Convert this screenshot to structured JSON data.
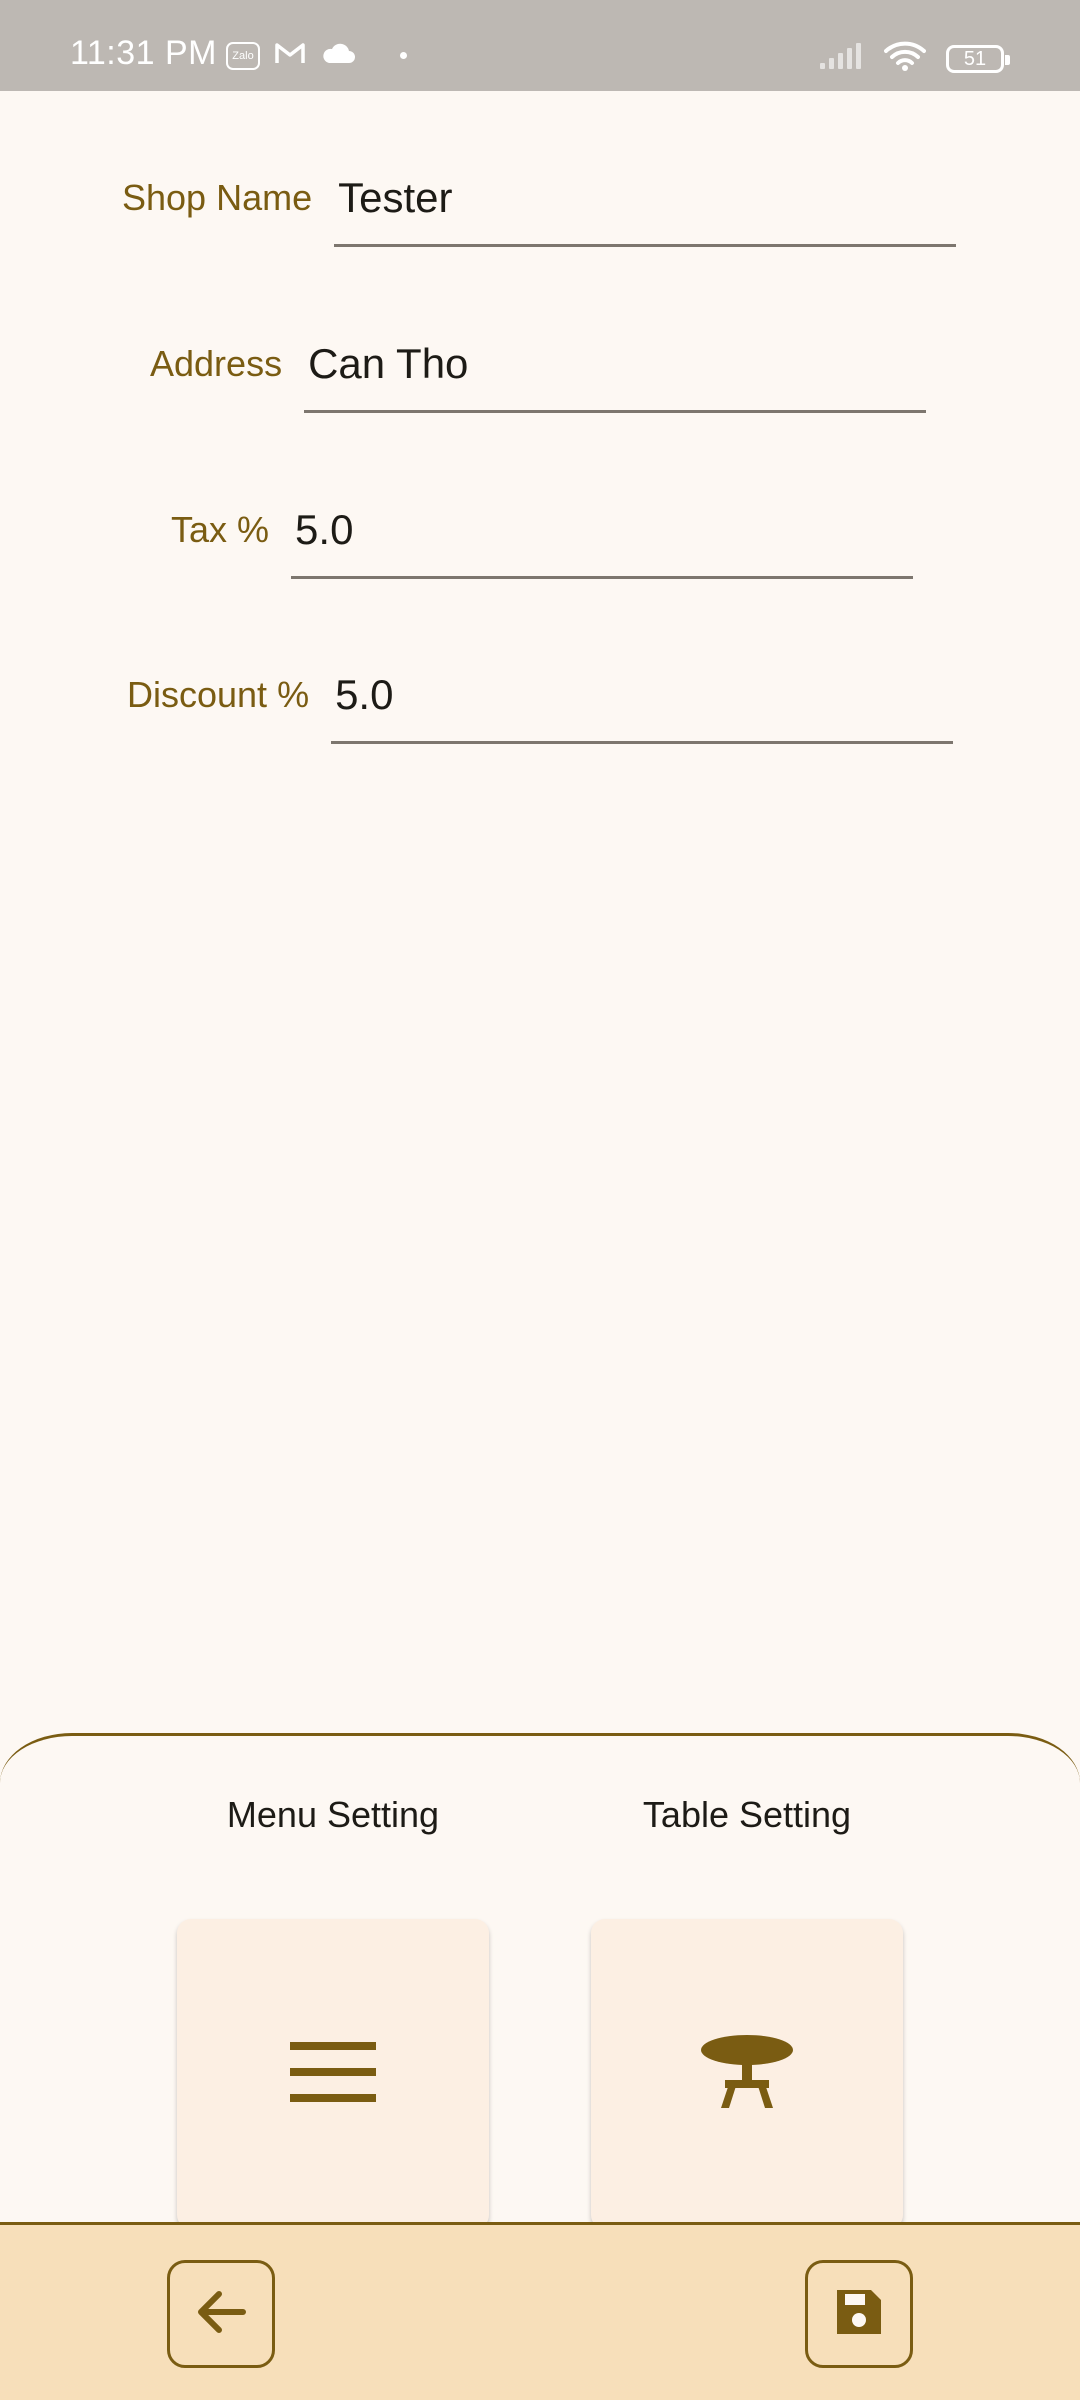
{
  "status_bar": {
    "time": "11:31 PM",
    "zalo_text": "Zalo",
    "battery_level": "51",
    "icons": [
      "zalo-icon",
      "gmail-icon",
      "cloud-icon",
      "signal-icon",
      "wifi-icon",
      "battery-icon"
    ]
  },
  "form": {
    "shop_name": {
      "label": "Shop Name",
      "value": "Tester"
    },
    "address": {
      "label": "Address",
      "value": "Can Tho"
    },
    "tax": {
      "label": "Tax %",
      "value": "5.0"
    },
    "discount": {
      "label": "Discount %",
      "value": "5.0"
    }
  },
  "settings": {
    "menu": {
      "label": "Menu Setting",
      "icon": "menu-icon"
    },
    "table": {
      "label": "Table Setting",
      "icon": "table-icon"
    }
  },
  "bottom_bar": {
    "back_icon": "arrow-back-icon",
    "save_icon": "save-icon"
  },
  "colors": {
    "accent": "#7a5c12",
    "background": "#fdf8f3",
    "card": "#fcefe3",
    "bottom_bar": "#f7dfba",
    "status_bar": "#bdb8b3"
  }
}
